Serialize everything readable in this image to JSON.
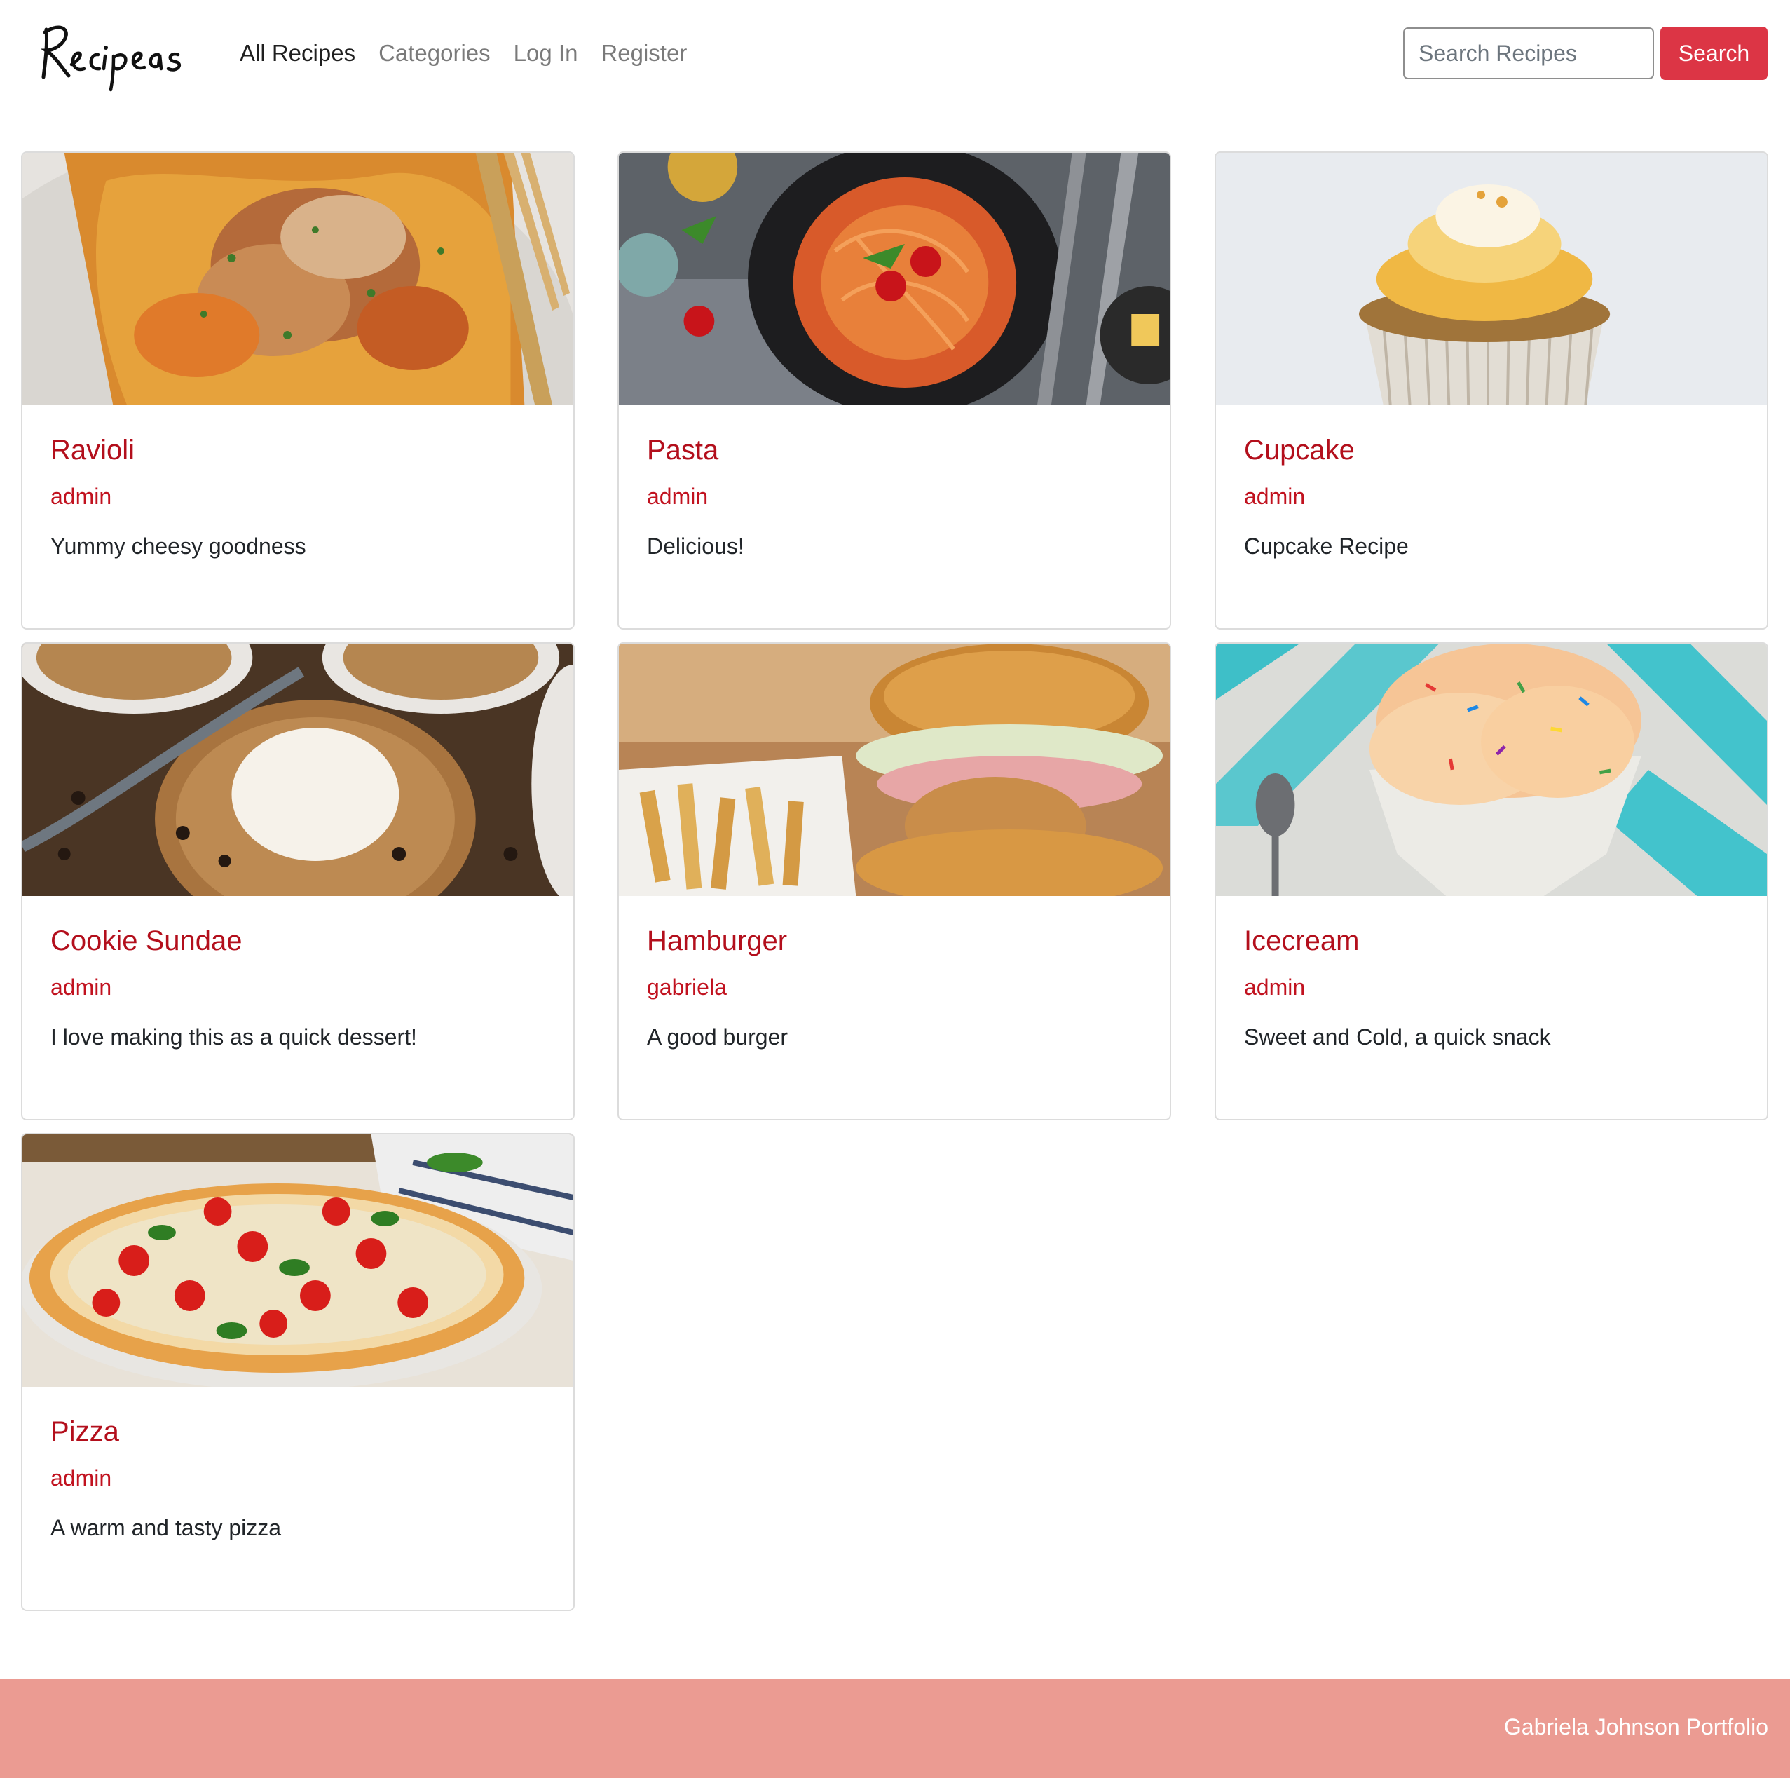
{
  "brand": {
    "logo_text": "Recipeas"
  },
  "nav": {
    "links": [
      {
        "label": "All Recipes"
      },
      {
        "label": "Categories"
      },
      {
        "label": "Log In"
      },
      {
        "label": "Register"
      }
    ]
  },
  "search": {
    "placeholder": "Search Recipes",
    "value": "",
    "button_label": "Search"
  },
  "colors": {
    "accent": "#dc3545",
    "title_red": "#b30f1c",
    "footer_bg": "#eb9b92"
  },
  "recipes": [
    {
      "title": "Ravioli",
      "author": "admin",
      "description": "Yummy cheesy goodness",
      "image": "ravioli"
    },
    {
      "title": "Pasta",
      "author": "admin",
      "description": "Delicious!",
      "image": "pasta"
    },
    {
      "title": "Cupcake",
      "author": "admin",
      "description": "Cupcake Recipe",
      "image": "cupcake"
    },
    {
      "title": "Cookie Sundae",
      "author": "admin",
      "description": "I love making this as a quick dessert!",
      "image": "cookie-sundae"
    },
    {
      "title": "Hamburger",
      "author": "gabriela",
      "description": "A good burger",
      "image": "hamburger"
    },
    {
      "title": "Icecream",
      "author": "admin",
      "description": "Sweet and Cold, a quick snack",
      "image": "icecream"
    },
    {
      "title": "Pizza",
      "author": "admin",
      "description": "A warm and tasty pizza",
      "image": "pizza"
    }
  ],
  "footer": {
    "text": "Gabriela Johnson Portfolio"
  }
}
